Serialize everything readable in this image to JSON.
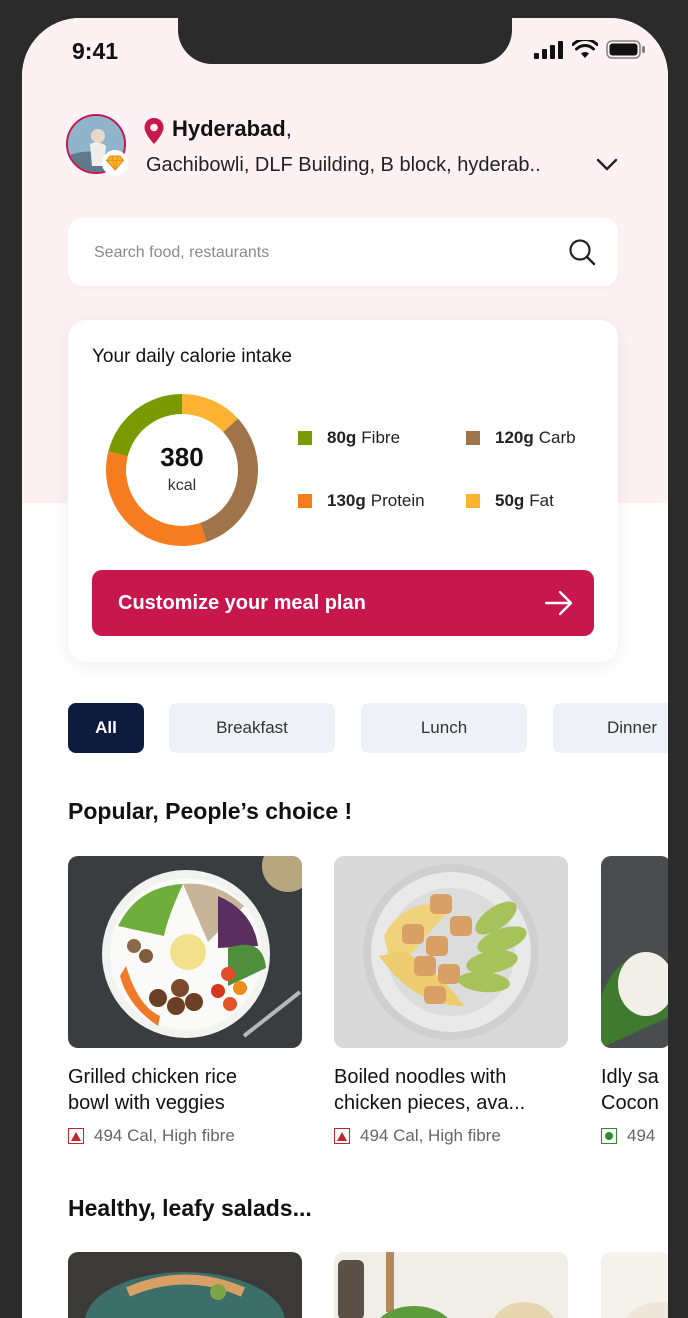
{
  "status_bar": {
    "time": "9:41"
  },
  "location": {
    "city": "Hyderabad",
    "city_suffix": ",",
    "address": "Gachibowli, DLF Building, B block, hyderab.."
  },
  "search": {
    "placeholder": "Search food, restaurants"
  },
  "calorie_card": {
    "title": "Your daily calorie intake",
    "total_value": "380",
    "total_unit": "kcal",
    "macros": [
      {
        "amount": "80g",
        "label": "Fibre",
        "color": "#7a9a01"
      },
      {
        "amount": "120g",
        "label": "Carb",
        "color": "#a0744a"
      },
      {
        "amount": "130g",
        "label": "Protein",
        "color": "#f57c1f"
      },
      {
        "amount": "50g",
        "label": "Fat",
        "color": "#fbb331"
      }
    ],
    "cta_label": "Customize your meal plan"
  },
  "categories": [
    "All",
    "Breakfast",
    "Lunch",
    "Dinner"
  ],
  "sections": {
    "popular_title": "Popular, People’s choice !",
    "salads_title": "Healthy, leafy salads..."
  },
  "popular_items": [
    {
      "name_line1": "Grilled chicken rice",
      "name_line2": "bowl with veggies",
      "meta": "494 Cal, High fibre",
      "type": "non-veg"
    },
    {
      "name_line1": "Boiled noodles with",
      "name_line2": "chicken pieces, ava...",
      "meta": "494 Cal, High fibre",
      "type": "non-veg"
    },
    {
      "name_line1": "Idly sa",
      "name_line2": "Cocon",
      "meta": "494",
      "type": "veg"
    }
  ],
  "colors": {
    "brand": "#c8174d",
    "active_chip": "#0d1b3d",
    "non_veg": "#c0262d",
    "veg": "#2e8b2e"
  }
}
